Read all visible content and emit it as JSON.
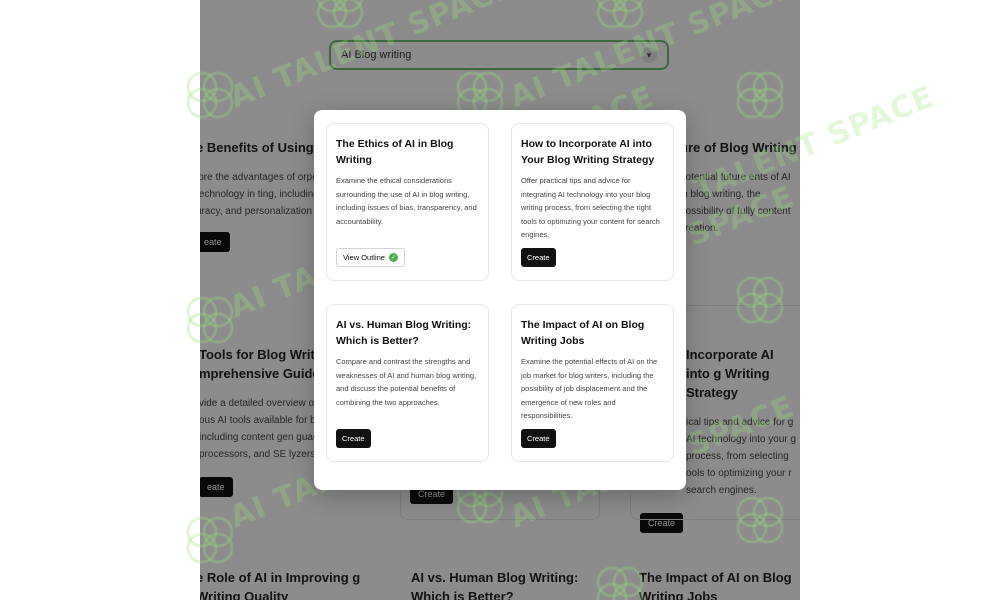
{
  "search": {
    "value": "AI Blog writing"
  },
  "background_cards": [
    {
      "title": "e Benefits of Using g Writing",
      "desc": "lore the advantages of orporating AI technology in ting, including improved e uracy, and personalization",
      "button": "eate"
    },
    {
      "title": "ure of Blog Writing",
      "desc": "potential future ents of AI in blog writing, the possibility of fully content creation.",
      "button": ""
    },
    {
      "title": "Tools for Blog Writin mprehensive Guide",
      "desc": "vide a detailed overview o ous AI tools available for b g, including content gen guage processors, and SE lyzers.",
      "button": "eate"
    },
    {
      "title": "",
      "desc": "",
      "button": "Create"
    },
    {
      "title": "Incorporate AI into g Writing Strategy",
      "desc": "ical tips and advice for g AI technology into your g process, from selecting ools to optimizing your r search engines.",
      "button": "Create"
    },
    {
      "title": "e Role of AI in Improving g Writing Quality",
      "desc": "",
      "button": ""
    },
    {
      "title": "AI vs. Human Blog Writing: Which is Better?",
      "desc": "",
      "button": ""
    },
    {
      "title": "The Impact of AI on Blog Writing Jobs",
      "desc": "",
      "button": ""
    }
  ],
  "watermark": {
    "text": "AI TALENT SPACE"
  },
  "modal": {
    "cards": [
      {
        "title": "The Ethics of AI in Blog Writing",
        "desc": "Examine the ethical considerations surrounding the use of AI in blog writing, including issues of bias, transparency, and accountability.",
        "button": "View Outline"
      },
      {
        "title": "How to Incorporate AI into Your Blog Writing Strategy",
        "desc": "Offer practical tips and advice for integrating AI technology into your blog writing process, from selecting the right tools to optimizing your content for search engines.",
        "button": "Create"
      },
      {
        "title": "AI vs. Human Blog Writing: Which is Better?",
        "desc": "Compare and contrast the strengths and weaknesses of AI and human blog writing, and discuss the potential benefits of combining the two approaches.",
        "button": "Create"
      },
      {
        "title": "The Impact of AI on Blog Writing Jobs",
        "desc": "Examine the potential effects of AI on the job market for blog writers, including the possibility of job displacement and the emergence of new roles and responsibilities.",
        "button": "Create"
      }
    ]
  },
  "colors": {
    "accent": "#6fbf73",
    "button": "#111111",
    "check": "#4caf50",
    "watermark": "#96e678"
  }
}
